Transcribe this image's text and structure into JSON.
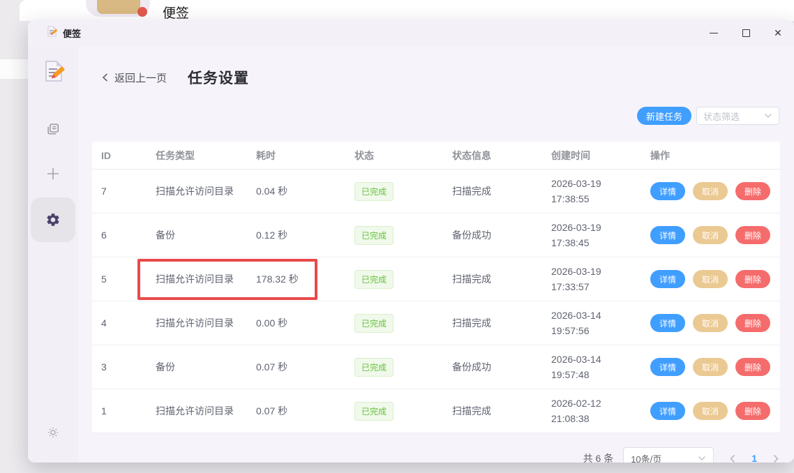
{
  "background": {
    "app_label": "便签"
  },
  "titlebar": {
    "app_title": "便签"
  },
  "header": {
    "back_label": "返回上一页",
    "page_title": "任务设置"
  },
  "toolbar": {
    "new_task_label": "新建任务",
    "status_filter_placeholder": "状态筛选"
  },
  "table": {
    "columns": [
      "ID",
      "任务类型",
      "耗时",
      "状态",
      "状态信息",
      "创建时间",
      "操作"
    ],
    "action_labels": {
      "detail": "详情",
      "cancel": "取消",
      "delete": "删除"
    },
    "rows": [
      {
        "id": "7",
        "task_type": "扫描允许访问目录",
        "duration": "0.04 秒",
        "status": "已完成",
        "status_info": "扫描完成",
        "created_date": "2026-03-19",
        "created_time": "17:38:55",
        "highlighted": false
      },
      {
        "id": "6",
        "task_type": "备份",
        "duration": "0.12 秒",
        "status": "已完成",
        "status_info": "备份成功",
        "created_date": "2026-03-19",
        "created_time": "17:38:45",
        "highlighted": false
      },
      {
        "id": "5",
        "task_type": "扫描允许访问目录",
        "duration": "178.32 秒",
        "status": "已完成",
        "status_info": "扫描完成",
        "created_date": "2026-03-19",
        "created_time": "17:33:57",
        "highlighted": true
      },
      {
        "id": "4",
        "task_type": "扫描允许访问目录",
        "duration": "0.00 秒",
        "status": "已完成",
        "status_info": "扫描完成",
        "created_date": "2026-03-14",
        "created_time": "19:57:56",
        "highlighted": false
      },
      {
        "id": "3",
        "task_type": "备份",
        "duration": "0.07 秒",
        "status": "已完成",
        "status_info": "备份成功",
        "created_date": "2026-03-14",
        "created_time": "19:57:48",
        "highlighted": false
      },
      {
        "id": "1",
        "task_type": "扫描允许访问目录",
        "duration": "0.07 秒",
        "status": "已完成",
        "status_info": "扫描完成",
        "created_date": "2026-02-12",
        "created_time": "21:08:38",
        "highlighted": false
      }
    ]
  },
  "pagination": {
    "total_label": "共 6 条",
    "page_size_label": "10条/页",
    "current_page": "1"
  },
  "colors": {
    "accent_blue": "#409EFF",
    "cancel_tan": "#EBC992",
    "danger_red": "#F56C6C",
    "success_green": "#67C23A",
    "success_bg": "#F0F9EB",
    "annotation_red": "#E84A4A",
    "sidebar_bg": "#F2EFF6",
    "content_bg": "#F6F4FA"
  },
  "icons": {
    "app_logo": "memo-pencil",
    "notes_icon": "documents",
    "add_icon": "plus",
    "settings_icon": "gear",
    "theme_icon": "sun",
    "back_icon": "chevron-left",
    "dropdown_icon": "chevron-down",
    "minimize_icon": "minus",
    "maximize_icon": "square",
    "close_icon": "x",
    "prev_page_icon": "chevron-left",
    "next_page_icon": "chevron-right"
  }
}
